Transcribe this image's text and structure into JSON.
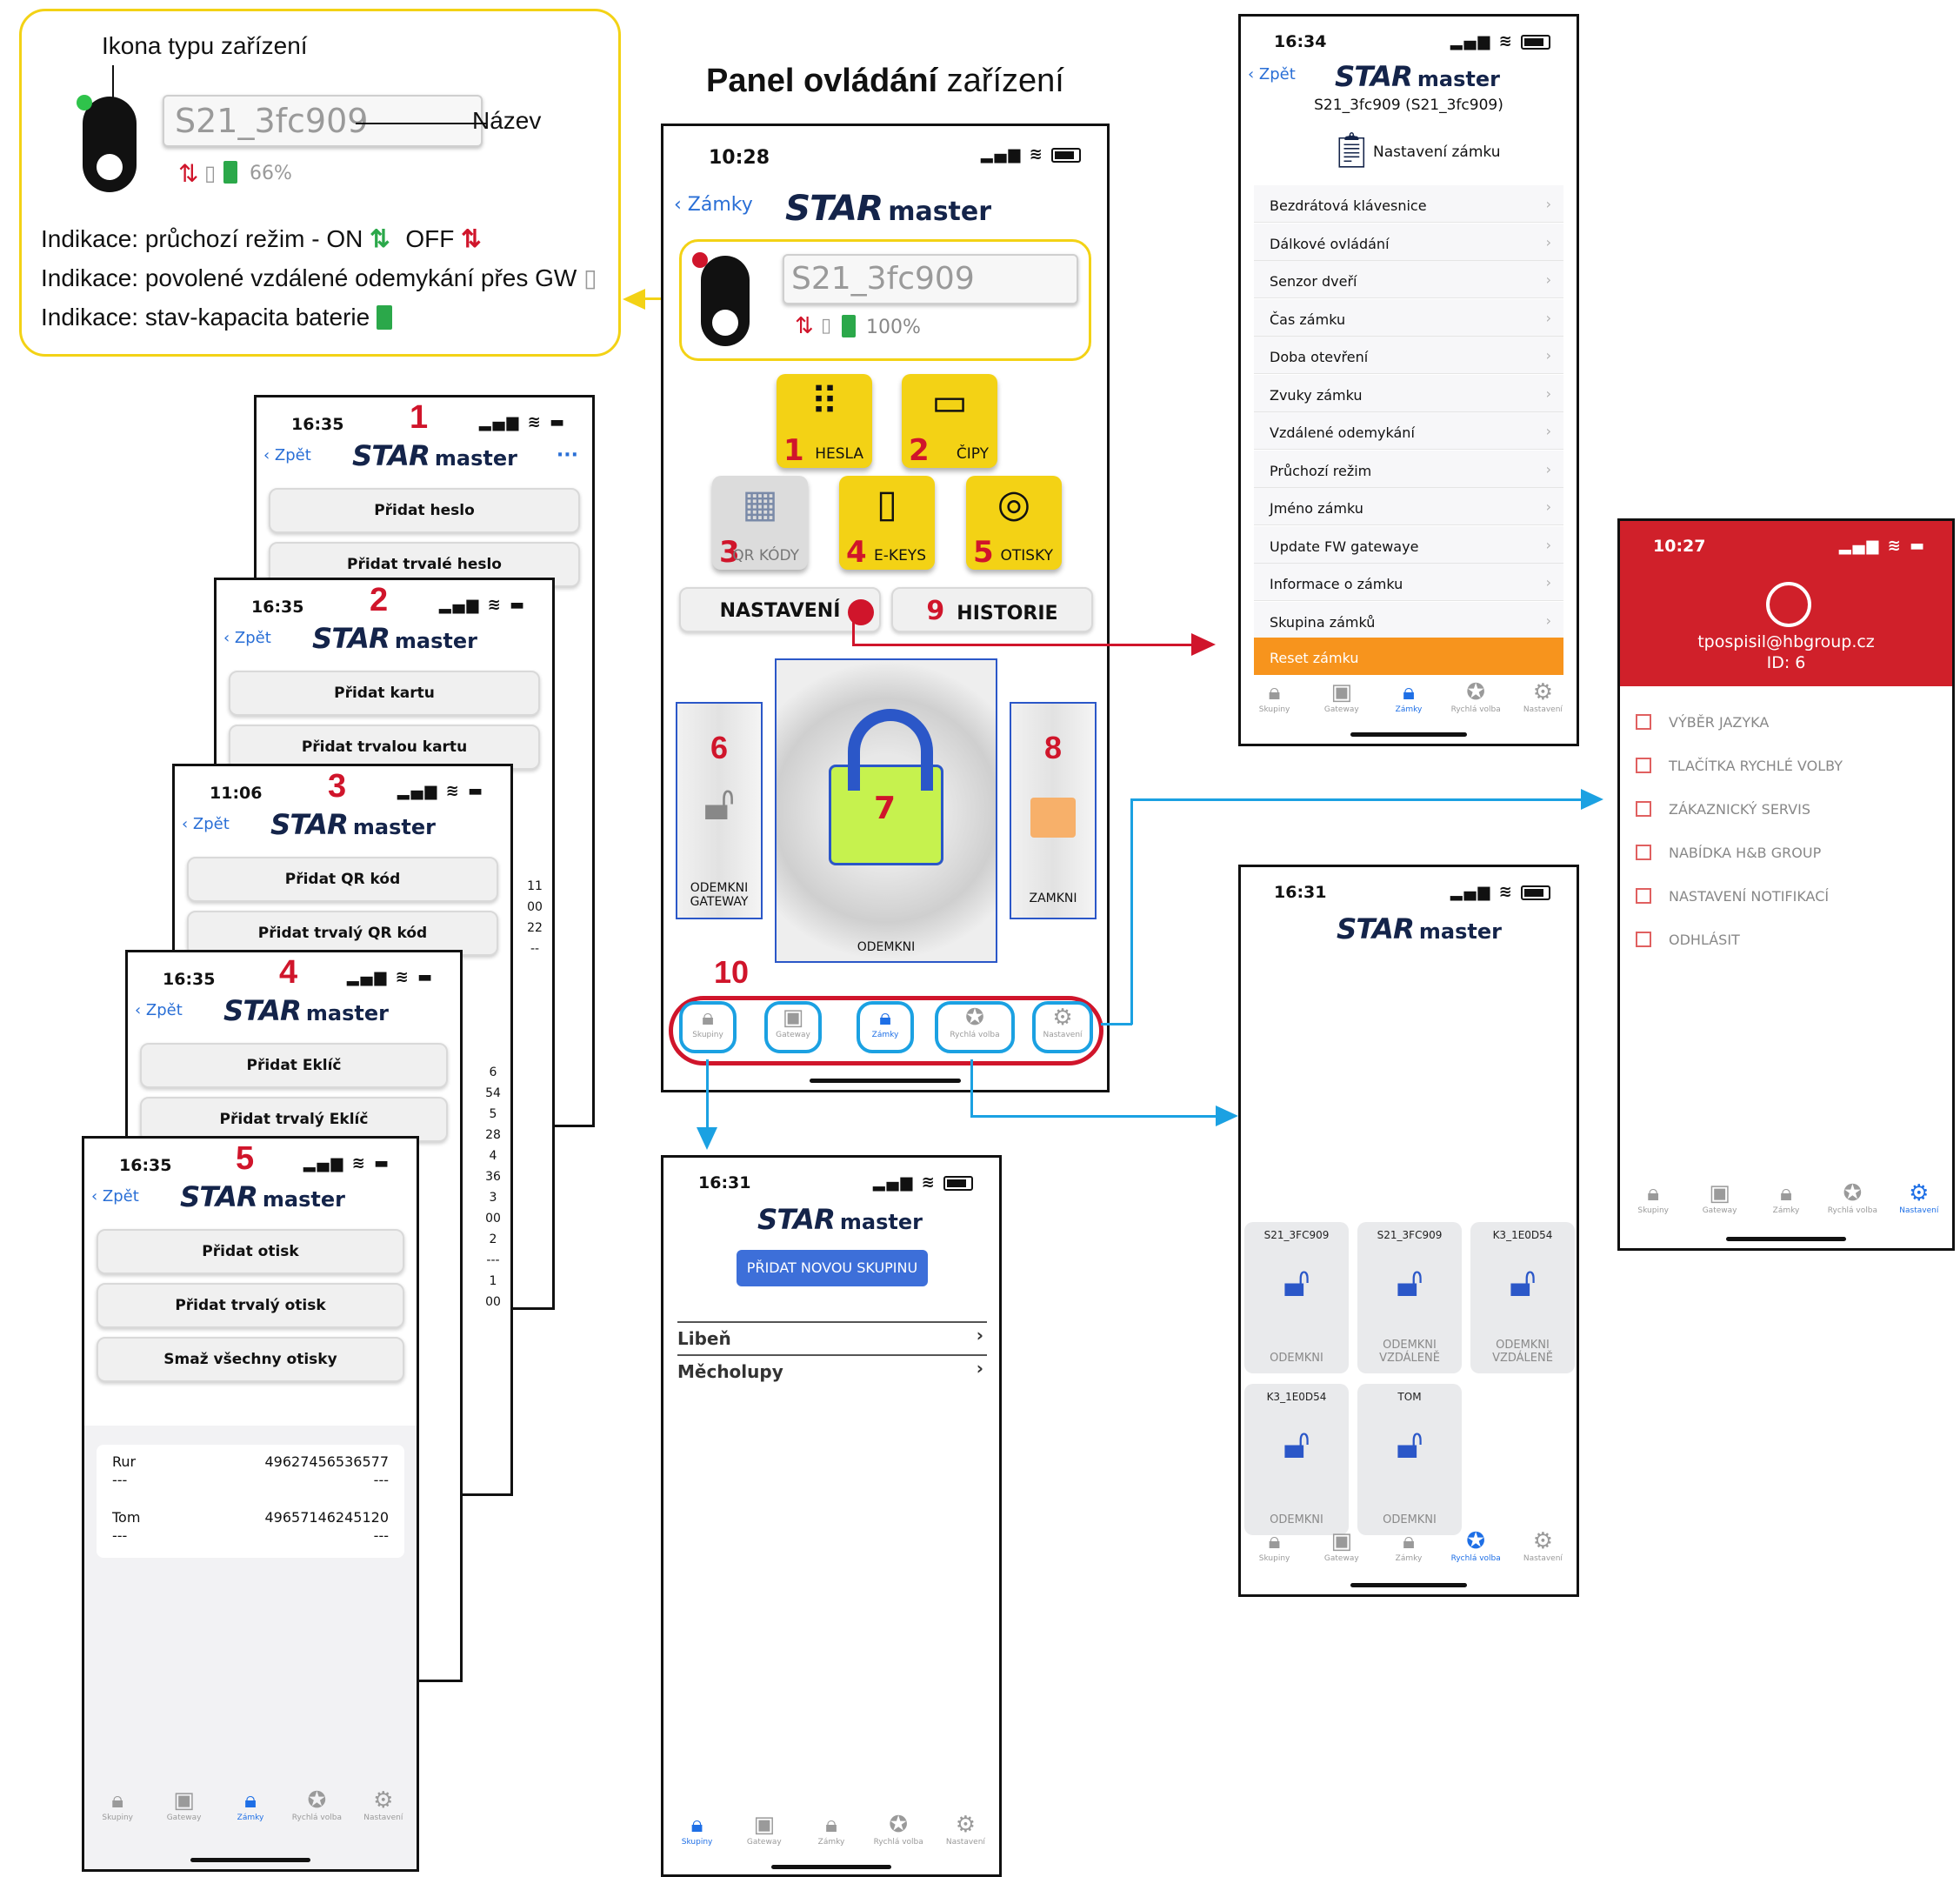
{
  "title_bold": "Panel ovládání",
  "title_rest": "zařízení",
  "logo": {
    "star": "STAR",
    "master": "master"
  },
  "back_label": "Zpět",
  "legend": {
    "icon_label": "Ikona typu zařízení",
    "device_name": "S21_3fc909",
    "name_label": "Název",
    "battery": "66%",
    "line1_a": "Indikace: průchozí režim - ON",
    "line1_b": "OFF",
    "line2": "Indikace: povolené vzdálené odemykání přes GW",
    "line3": "Indikace: stav-kapacita baterie"
  },
  "main": {
    "time": "10:28",
    "back": "Zámky",
    "device_name": "S21_3fc909",
    "battery": "100%",
    "features": [
      {
        "num": "1",
        "label": "HESLA",
        "icon": "keypad-icon"
      },
      {
        "num": "2",
        "label": "ČIPY",
        "icon": "card-icon"
      },
      {
        "num": "3",
        "label": "QR KÓDY",
        "icon": "qr-icon"
      },
      {
        "num": "4",
        "label": "E-KEYS",
        "icon": "phone-key-icon"
      },
      {
        "num": "5",
        "label": "OTISKY",
        "icon": "fingerprint-icon"
      }
    ],
    "settings": "NASTAVENÍ",
    "history_num": "9",
    "history": "HISTORIE",
    "gw_num": "6",
    "gw_label1": "ODEMKNI",
    "gw_label2": "GATEWAY",
    "unlock_num": "7",
    "unlock_label": "ODEMKNI",
    "lock_num": "8",
    "lock_label": "ZAMKNI",
    "tabbar_num": "10"
  },
  "tabs": [
    "Skupiny",
    "Gateway",
    "Zámky",
    "Rychlá volba",
    "Nastavení"
  ],
  "stack": [
    {
      "time": "16:35",
      "num": "1",
      "buttons": [
        "Přidat heslo",
        "Přidat trvalé heslo"
      ],
      "has_more": true
    },
    {
      "time": "16:35",
      "num": "2",
      "buttons": [
        "Přidat kartu",
        "Přidat trvalou kartu"
      ],
      "side": [
        "11",
        "00",
        "22",
        "--"
      ]
    },
    {
      "time": "11:06",
      "num": "3",
      "buttons": [
        "Přidat QR kód",
        "Přidat trvalý QR kód"
      ],
      "side": [
        "6",
        "54",
        "5",
        "28",
        "4",
        "36",
        "3",
        "00",
        "2",
        "---",
        "1",
        "00"
      ]
    },
    {
      "time": "16:35",
      "num": "4",
      "buttons": [
        "Přidat Eklíč",
        "Přidat trvalý Eklíč"
      ]
    },
    {
      "time": "16:35",
      "num": "5",
      "buttons": [
        "Přidat otisk",
        "Přidat trvalý otisk",
        "Smaž všechny otisky"
      ],
      "rows": [
        {
          "name": "Rur",
          "id": "49627456536577",
          "a": "---",
          "b": "---"
        },
        {
          "name": "Tom",
          "id": "49657146245120",
          "a": "---",
          "b": "---"
        }
      ]
    }
  ],
  "settings_phone": {
    "time": "16:34",
    "subtitle": "S21_3fc909 (S21_3fc909)",
    "heading": "Nastavení zámku",
    "items": [
      "Bezdrátová klávesnice",
      "Dálkové ovládání",
      "Senzor dveří",
      "Čas zámku",
      "Doba otevření",
      "Zvuky zámku",
      "Vzdálené odemykání",
      "Průchozí režim",
      "Jméno zámku",
      "Update FW gatewaye",
      "Informace o zámku",
      "Skupina zámků"
    ],
    "reset": "Reset zámku"
  },
  "account_phone": {
    "time": "10:27",
    "email": "tpospisil@hbgroup.cz",
    "id": "ID: 6",
    "items": [
      "VÝBĚR JAZYKA",
      "TLAČÍTKA RYCHLÉ VOLBY",
      "ZÁKAZNICKÝ SERVIS",
      "NABÍDKA H&B GROUP",
      "NASTAVENÍ NOTIFIKACÍ",
      "ODHLÁSIT"
    ]
  },
  "quick_phone": {
    "time": "16:31",
    "tiles": [
      {
        "title": "S21_3FC909",
        "label": "ODEMKNI"
      },
      {
        "title": "S21_3FC909",
        "label": "ODEMKNI VZDÁLENĚ"
      },
      {
        "title": "K3_1E0D54",
        "label": "ODEMKNI VZDÁLENĚ"
      },
      {
        "title": "K3_1E0D54",
        "label": "ODEMKNI"
      },
      {
        "title": "TOM",
        "label": "ODEMKNI"
      }
    ]
  },
  "groups_phone": {
    "time": "16:31",
    "add_button": "PŘIDAT NOVOU SKUPINU",
    "groups": [
      "Libeň",
      "Měcholupy"
    ]
  },
  "colors": {
    "red": "#d0152b",
    "yellow": "#f3d215",
    "blue": "#1ba1e2",
    "navy": "#14244a",
    "orange": "#f7941d"
  }
}
